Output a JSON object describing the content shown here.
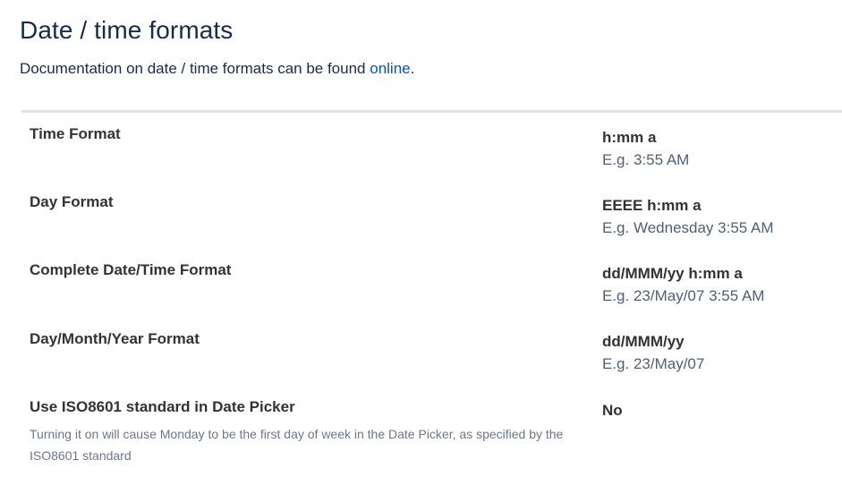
{
  "page": {
    "title": "Date / time formats",
    "intro_text": "Documentation on date / time formats can be found ",
    "intro_link": "online",
    "intro_end": "."
  },
  "settings": [
    {
      "label": "Time Format",
      "value": "h:mm a",
      "example": "E.g. 3:55 AM"
    },
    {
      "label": "Day Format",
      "value": "EEEE h:mm a",
      "example": "E.g. Wednesday 3:55 AM"
    },
    {
      "label": "Complete Date/Time Format",
      "value": "dd/MMM/yy h:mm a",
      "example": "E.g. 23/May/07 3:55 AM"
    },
    {
      "label": "Day/Month/Year Format",
      "value": "dd/MMM/yy",
      "example": "E.g. 23/May/07"
    },
    {
      "label": "Use ISO8601 standard in Date Picker",
      "description": "Turning it on will cause Monday to be the first day of week in the Date Picker, as specified by the ISO8601 standard",
      "value": "No"
    }
  ]
}
